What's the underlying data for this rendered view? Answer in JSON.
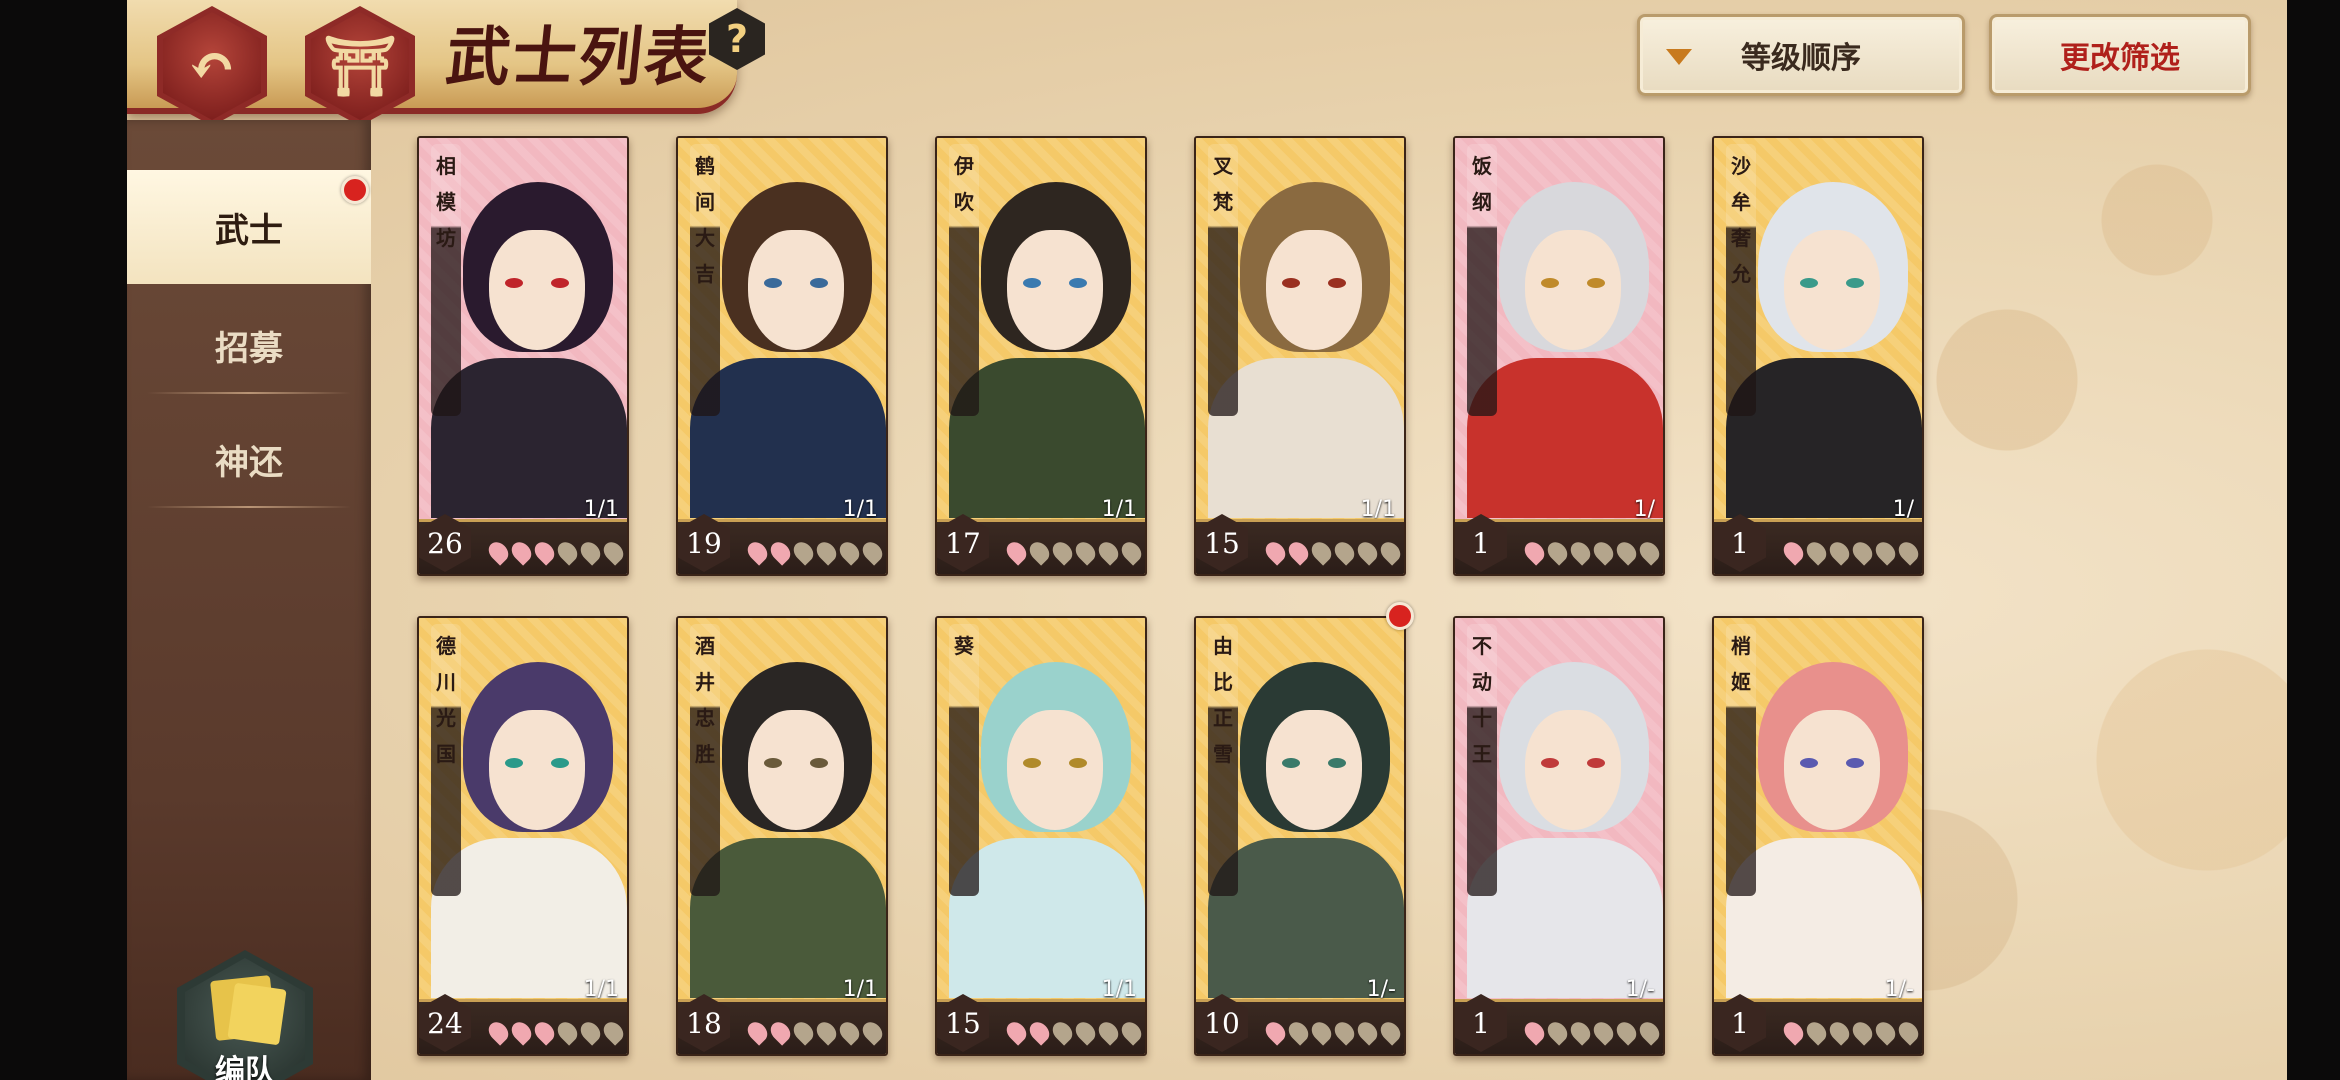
{
  "header": {
    "title": "武士列表",
    "help": "?",
    "sort_label": "等级顺序",
    "filter_label": "更改筛选"
  },
  "sidebar": {
    "items": [
      {
        "label": "武士",
        "active": true,
        "badge": true
      },
      {
        "label": "招募",
        "active": false,
        "badge": false
      },
      {
        "label": "神还",
        "active": false,
        "badge": false
      }
    ],
    "team_label": "编队"
  },
  "cards": [
    {
      "name": "相模坊",
      "level": "26",
      "count": "1/1",
      "stars": 3,
      "bg": "#f2b8c0",
      "hair": "#2a1a2e",
      "body": "#2b2430",
      "eye": "#c0242a",
      "badge": false
    },
    {
      "name": "鹤间大吉",
      "level": "19",
      "count": "1/1",
      "stars": 2,
      "bg": "#f5c968",
      "hair": "#4a3020",
      "body": "#22304e",
      "eye": "#3a6a9a",
      "badge": false
    },
    {
      "name": "伊吹",
      "level": "17",
      "count": "1/1",
      "stars": 1,
      "bg": "#f5c968",
      "hair": "#2e2620",
      "body": "#3a4a2e",
      "eye": "#3a7ab0",
      "badge": false
    },
    {
      "name": "叉梵",
      "level": "15",
      "count": "1/1",
      "stars": 2,
      "bg": "#f5c968",
      "hair": "#8a6a40",
      "body": "#e8dfd2",
      "eye": "#9a3020",
      "badge": false
    },
    {
      "name": "饭纲",
      "level": "1",
      "count": "1/",
      "stars": 1,
      "bg": "#f2b8c0",
      "hair": "#d8d8dc",
      "body": "#c8322c",
      "eye": "#c08a2a",
      "badge": false
    },
    {
      "name": "沙牟奢允",
      "level": "1",
      "count": "1/",
      "stars": 1,
      "bg": "#f5c968",
      "hair": "#e0e4ea",
      "body": "#262426",
      "eye": "#3a9a8a",
      "badge": false
    },
    {
      "name": "德川光国",
      "level": "24",
      "count": "1/1",
      "stars": 3,
      "bg": "#f5c968",
      "hair": "#4a3a6a",
      "body": "#f2eee6",
      "eye": "#2a9a8a",
      "badge": false
    },
    {
      "name": "酒井忠胜",
      "level": "18",
      "count": "1/1",
      "stars": 2,
      "bg": "#f5c968",
      "hair": "#2a2624",
      "body": "#4a5a3a",
      "eye": "#6a5a3a",
      "badge": false
    },
    {
      "name": "葵",
      "level": "15",
      "count": "1/1",
      "stars": 2,
      "bg": "#f5c968",
      "hair": "#9ad2cc",
      "body": "#cfe8ea",
      "eye": "#b08a2a",
      "badge": false
    },
    {
      "name": "由比正雪",
      "level": "10",
      "count": "1/-",
      "stars": 1,
      "bg": "#f5c968",
      "hair": "#2a3a34",
      "body": "#4a5a4a",
      "eye": "#3a7a6a",
      "badge": true
    },
    {
      "name": "不动十王",
      "level": "1",
      "count": "1/-",
      "stars": 1,
      "bg": "#f2b8c0",
      "hair": "#dadde2",
      "body": "#e6e6ea",
      "eye": "#c03a3a",
      "badge": false
    },
    {
      "name": "梢姬",
      "level": "1",
      "count": "1/-",
      "stars": 1,
      "bg": "#f5c968",
      "hair": "#e8908c",
      "body": "#f4ece4",
      "eye": "#5a5ab0",
      "badge": false
    }
  ]
}
